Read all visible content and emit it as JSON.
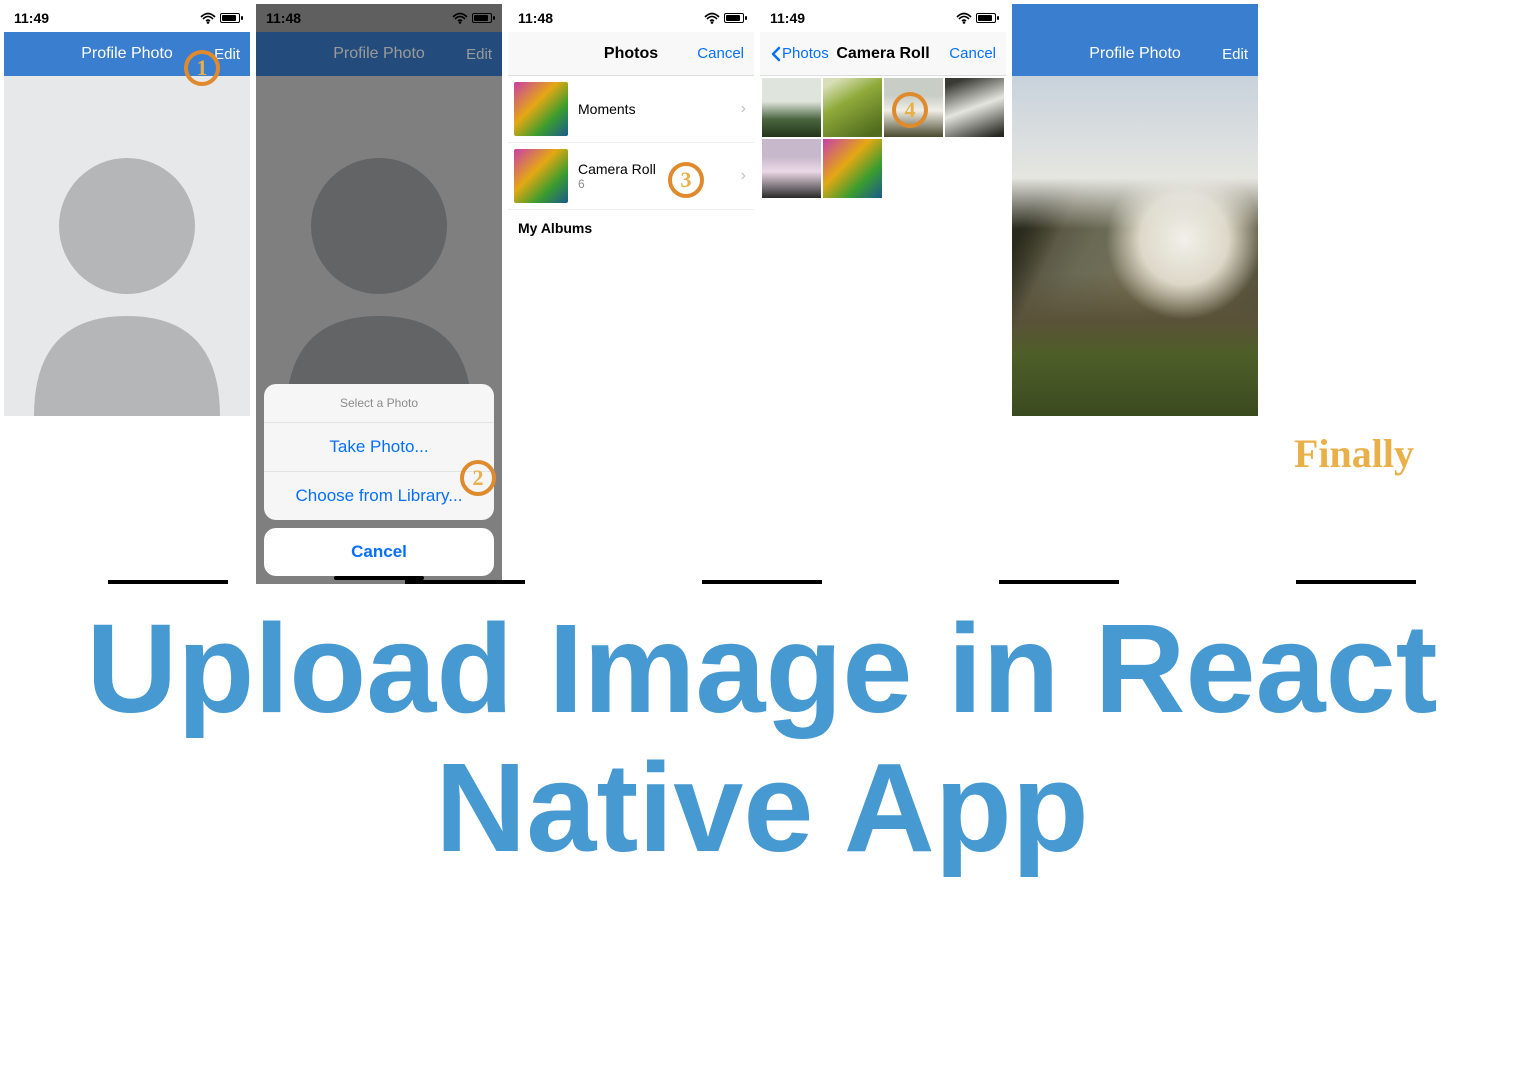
{
  "annotations": {
    "step1": "1",
    "step2": "2",
    "step3": "3",
    "step4": "4",
    "finally": "Finally"
  },
  "headline": "Upload Image in React Native App",
  "screen1": {
    "time": "11:49",
    "title": "Profile Photo",
    "editLabel": "Edit"
  },
  "screen2": {
    "time": "11:48",
    "title": "Profile Photo",
    "editLabel": "Edit",
    "sheetTitle": "Select a Photo",
    "takePhoto": "Take Photo...",
    "chooseLibrary": "Choose from Library...",
    "cancel": "Cancel"
  },
  "screen3": {
    "time": "11:48",
    "title": "Photos",
    "cancel": "Cancel",
    "albums": [
      {
        "name": "Moments",
        "count": ""
      },
      {
        "name": "Camera Roll",
        "count": "6"
      }
    ],
    "sectionHeader": "My Albums"
  },
  "screen4": {
    "time": "11:49",
    "back": "Photos",
    "title": "Camera Roll",
    "cancel": "Cancel"
  },
  "screen5": {
    "title": "Profile Photo",
    "editLabel": "Edit"
  }
}
